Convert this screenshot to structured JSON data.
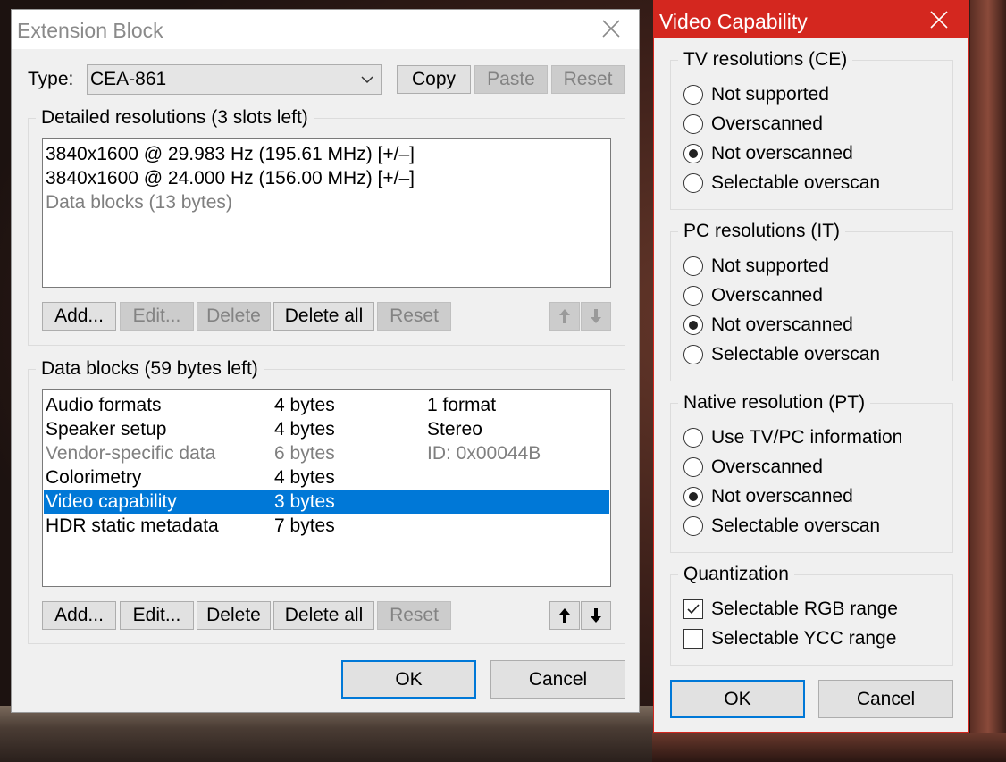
{
  "extension_block": {
    "title": "Extension Block",
    "type_label": "Type:",
    "type_value": "CEA-861",
    "copy_label": "Copy",
    "paste_label": "Paste",
    "reset_label": "Reset",
    "detailed": {
      "legend": "Detailed resolutions (3 slots left)",
      "rows": [
        "3840x1600 @ 29.983 Hz (195.61 MHz) [+/–]",
        "3840x1600 @ 24.000 Hz (156.00 MHz) [+/–]",
        "Data blocks (13 bytes)"
      ],
      "add_label": "Add...",
      "edit_label": "Edit...",
      "delete_label": "Delete",
      "delete_all_label": "Delete all",
      "reset_label": "Reset"
    },
    "data_blocks": {
      "legend": "Data blocks (59 bytes left)",
      "rows": [
        {
          "name": "Audio formats",
          "size": "4 bytes",
          "info": "1 format"
        },
        {
          "name": "Speaker setup",
          "size": "4 bytes",
          "info": "Stereo"
        },
        {
          "name": "Vendor-specific data",
          "size": "6 bytes",
          "info": "ID: 0x00044B"
        },
        {
          "name": "Colorimetry",
          "size": "4 bytes",
          "info": ""
        },
        {
          "name": "Video capability",
          "size": "3 bytes",
          "info": ""
        },
        {
          "name": "HDR static metadata",
          "size": "7 bytes",
          "info": ""
        }
      ],
      "add_label": "Add...",
      "edit_label": "Edit...",
      "delete_label": "Delete",
      "delete_all_label": "Delete all",
      "reset_label": "Reset"
    },
    "ok_label": "OK",
    "cancel_label": "Cancel"
  },
  "video_capability": {
    "title": "Video Capability",
    "tv": {
      "legend": "TV resolutions (CE)",
      "options": [
        "Not supported",
        "Overscanned",
        "Not overscanned",
        "Selectable overscan"
      ],
      "selected": "Not overscanned"
    },
    "pc": {
      "legend": "PC resolutions (IT)",
      "options": [
        "Not supported",
        "Overscanned",
        "Not overscanned",
        "Selectable overscan"
      ],
      "selected": "Not overscanned"
    },
    "native": {
      "legend": "Native resolution (PT)",
      "options": [
        "Use TV/PC information",
        "Overscanned",
        "Not overscanned",
        "Selectable overscan"
      ],
      "selected": "Not overscanned"
    },
    "quantization": {
      "legend": "Quantization",
      "rgb_label": "Selectable RGB range",
      "rgb_checked": true,
      "ycc_label": "Selectable YCC range",
      "ycc_checked": false
    },
    "ok_label": "OK",
    "cancel_label": "Cancel"
  },
  "colors": {
    "accent": "#0078d7",
    "vc_title_bar": "#d4271f"
  }
}
